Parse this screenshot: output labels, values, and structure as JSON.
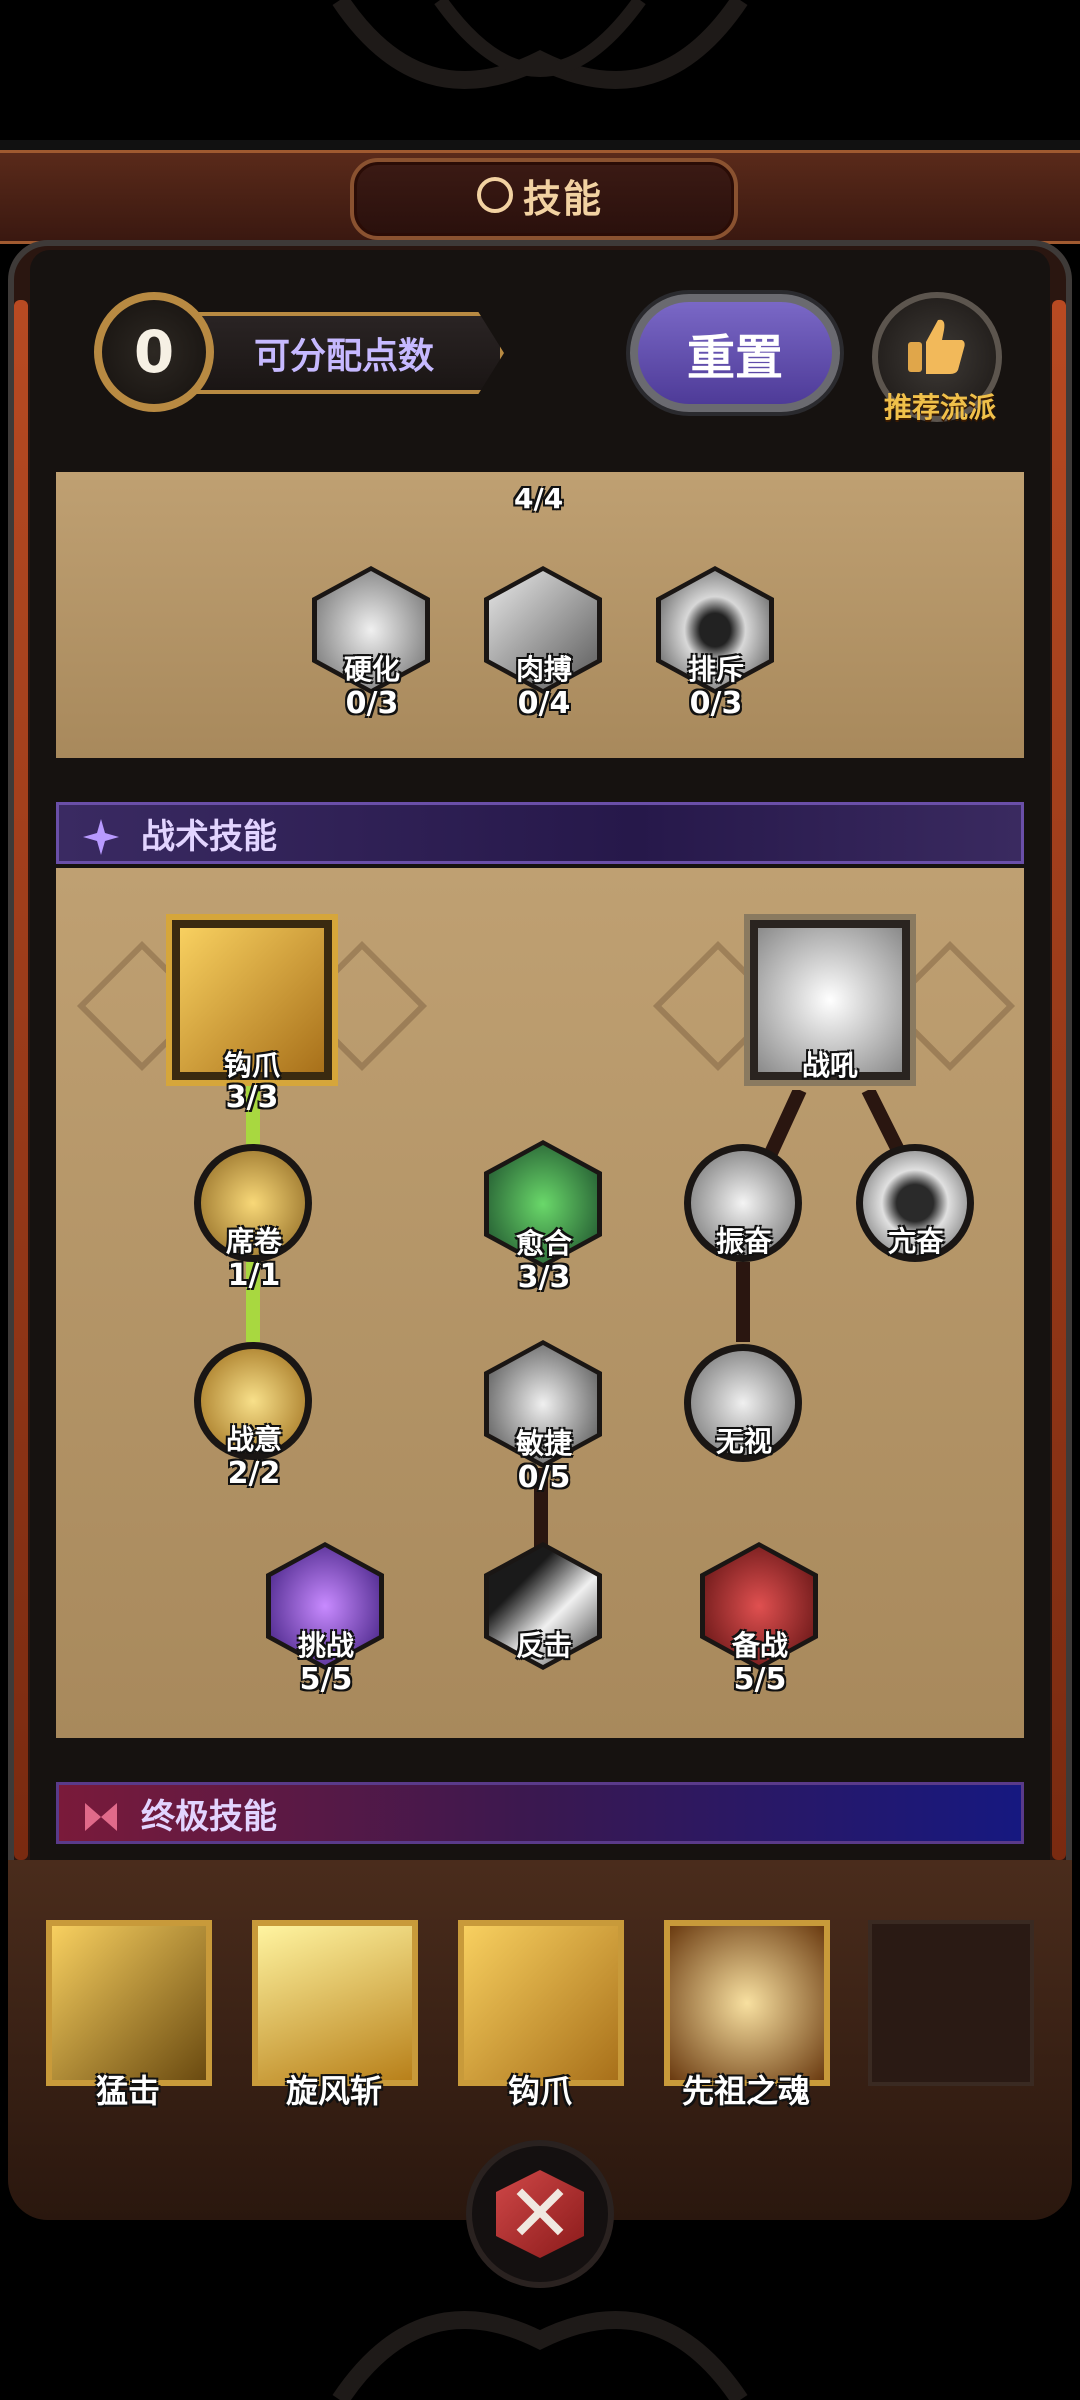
{
  "header": {
    "title": "技能"
  },
  "points": {
    "value": "0",
    "label": "可分配点数"
  },
  "reset_label": "重置",
  "recommend_label": "推荐流派",
  "top_panel": {
    "partial_count": "4/4",
    "nodes": [
      {
        "name": "硬化",
        "count": "0/3"
      },
      {
        "name": "肉搏",
        "count": "0/4"
      },
      {
        "name": "排斥",
        "count": "0/3"
      }
    ]
  },
  "tactical": {
    "title": "战术技能",
    "nodes": {
      "hook": {
        "name": "钩爪",
        "count": "3/3"
      },
      "roar": {
        "name": "战吼"
      },
      "sweep": {
        "name": "席卷",
        "count": "1/1"
      },
      "heal": {
        "name": "愈合",
        "count": "3/3"
      },
      "inspire": {
        "name": "振奋"
      },
      "excite": {
        "name": "亢奋"
      },
      "will": {
        "name": "战意",
        "count": "2/2"
      },
      "agile": {
        "name": "敏捷",
        "count": "0/5"
      },
      "ignore": {
        "name": "无视"
      },
      "taunt": {
        "name": "挑战",
        "count": "5/5"
      },
      "counter": {
        "name": "反击"
      },
      "ready": {
        "name": "备战",
        "count": "5/5"
      }
    }
  },
  "ultimate": {
    "title": "终极技能"
  },
  "slots": [
    {
      "name": "猛击"
    },
    {
      "name": "旋风斩"
    },
    {
      "name": "钩爪"
    },
    {
      "name": "先祖之魂"
    }
  ],
  "colors": {
    "accent": "#7a68c6",
    "gold": "#d6a63a",
    "active_line": "#a8d840",
    "panel": "#bfa072"
  },
  "icons": {
    "title": "wheel-icon",
    "recommend": "thumbs-up-icon",
    "close": "crossed-swords-icon"
  }
}
